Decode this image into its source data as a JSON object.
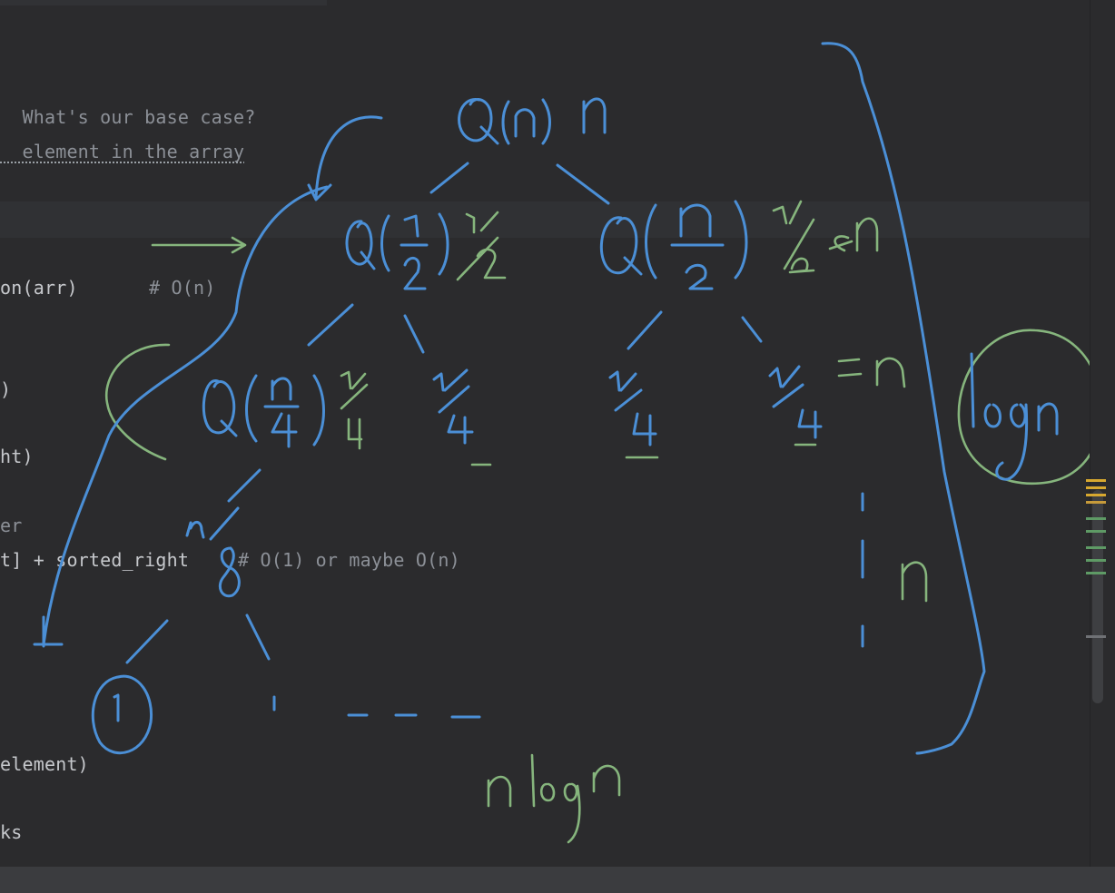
{
  "code_lines": [
    {
      "text": "  What's our base case?",
      "style": "comment"
    },
    {
      "text": "  element in the array",
      "style": "comment-underlined"
    },
    {
      "text": "on(arr)",
      "style": "code"
    },
    {
      "text": "# O(n)",
      "style": "comment"
    },
    {
      "text": ")",
      "style": "code"
    },
    {
      "text": "ht)",
      "style": "code"
    },
    {
      "text": "er",
      "style": "comment"
    },
    {
      "text": "t] + sorted_right",
      "style": "code"
    },
    {
      "text": "# O(1) or maybe O(n)",
      "style": "comment"
    },
    {
      "text": "element)",
      "style": "code"
    },
    {
      "text": "ks",
      "style": "code"
    }
  ],
  "colors": {
    "ink_blue": "#4b8fd6",
    "ink_green": "#86b57d",
    "editor_bg": "#2b2b2d",
    "marker_yellow": "#d7a82f",
    "marker_green": "#5e9a65"
  }
}
